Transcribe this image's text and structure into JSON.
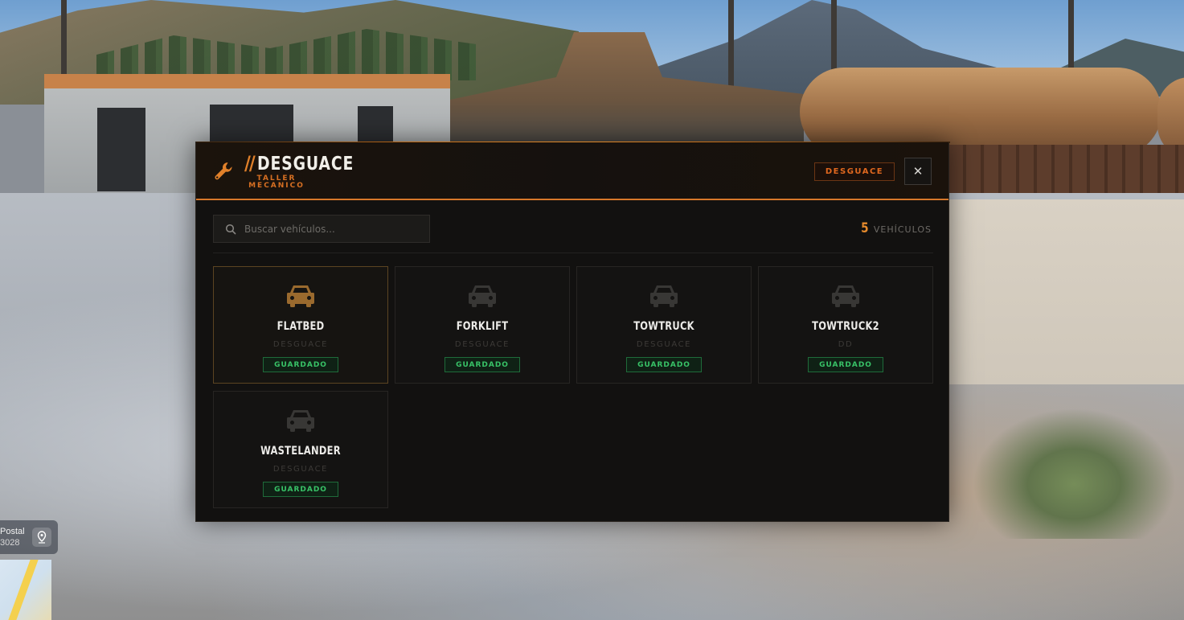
{
  "header": {
    "title_prefix": "//",
    "title": "DESGUACE",
    "subtitle_line1": "TALLER",
    "subtitle_line2": "MECANICO",
    "badge": "DESGUACE",
    "close_symbol": "✕"
  },
  "search": {
    "placeholder": "Buscar vehículos...",
    "value": ""
  },
  "count": {
    "value": "5",
    "label": "VEHÍCULOS"
  },
  "vehicles": [
    {
      "name": "FLATBED",
      "owner": "DESGUACE",
      "status": "GUARDADO",
      "selected": true
    },
    {
      "name": "FORKLIFT",
      "owner": "DESGUACE",
      "status": "GUARDADO",
      "selected": false
    },
    {
      "name": "TOWTRUCK",
      "owner": "DESGUACE",
      "status": "GUARDADO",
      "selected": false
    },
    {
      "name": "TOWTRUCK2",
      "owner": "DD",
      "status": "GUARDADO",
      "selected": false
    },
    {
      "name": "WASTELANDER",
      "owner": "DESGUACE",
      "status": "GUARDADO",
      "selected": false
    }
  ],
  "minimap": {
    "line1": "Postal",
    "line2": "3028"
  },
  "icons": {
    "header": "wrench-icon",
    "search": "search-icon",
    "card": "car-icon",
    "minimap": "map-pin-icon"
  },
  "colors": {
    "accent": "#e0802a",
    "status_green": "#38c267",
    "selected_car_icon": "#9a6a2e",
    "car_icon": "#3a3a3a"
  }
}
